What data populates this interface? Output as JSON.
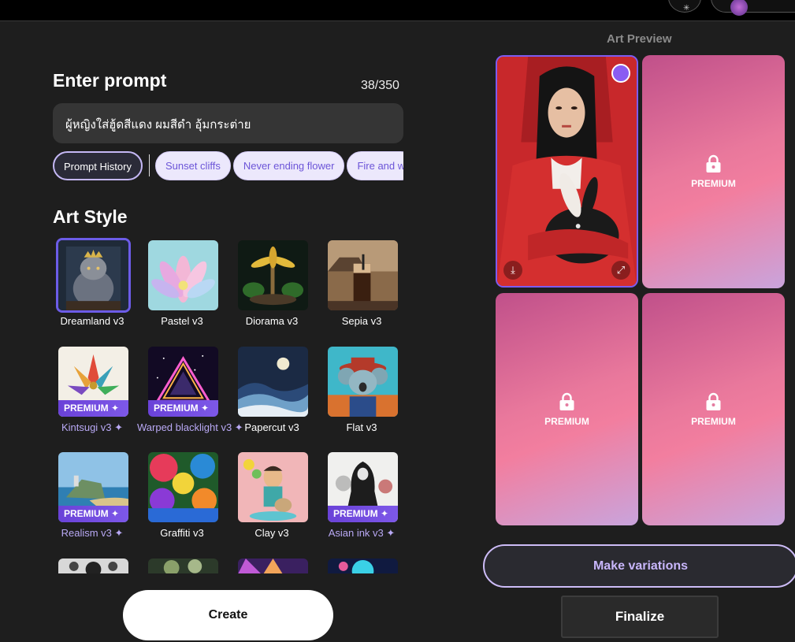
{
  "prompt": {
    "title": "Enter prompt",
    "count": "38/350",
    "text": "ผู้หญิงใส่ฮู้ดสีแดง ผมสีดำ อุ้มกระต่าย"
  },
  "chips": {
    "history": "Prompt History",
    "suggestions": [
      "Sunset cliffs",
      "Never ending flower",
      "Fire and w"
    ]
  },
  "art_style": {
    "title": "Art Style",
    "premium_badge": "PREMIUM ✦",
    "items": [
      {
        "label": "Dreamland v3",
        "premium": false,
        "selected": true
      },
      {
        "label": "Pastel v3",
        "premium": false
      },
      {
        "label": "Diorama v3",
        "premium": false
      },
      {
        "label": "Sepia v3",
        "premium": false
      },
      {
        "label": "Kintsugi v3 ✦",
        "premium": true
      },
      {
        "label": "Warped blacklight v3 ✦",
        "premium": true
      },
      {
        "label": "Papercut v3",
        "premium": false
      },
      {
        "label": "Flat v3",
        "premium": false
      },
      {
        "label": "Realism v3 ✦",
        "premium": true
      },
      {
        "label": "Graffiti v3",
        "premium": false
      },
      {
        "label": "Clay v3",
        "premium": false
      },
      {
        "label": "Asian ink v3 ✦",
        "premium": true
      }
    ]
  },
  "buttons": {
    "create": "Create",
    "make_variations": "Make variations",
    "finalize": "Finalize"
  },
  "preview": {
    "title": "Art Preview",
    "locked_label": "PREMIUM"
  },
  "colors": {
    "accent": "#7d5cf0",
    "premium_band": "#6a42d8"
  }
}
